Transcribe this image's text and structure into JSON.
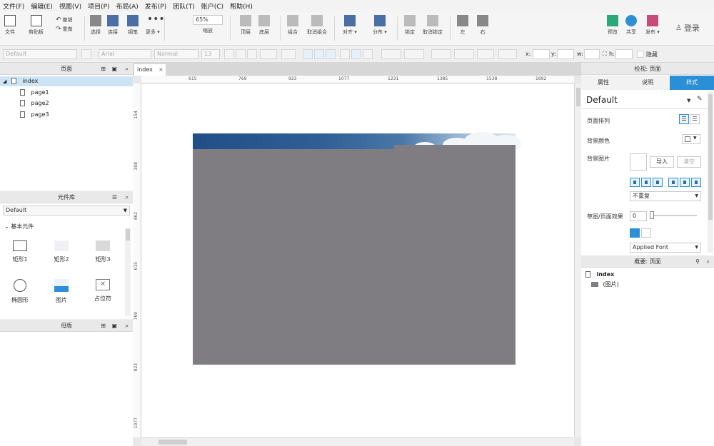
{
  "menu": [
    "文件(F)",
    "编辑(E)",
    "视图(V)",
    "项目(P)",
    "布局(A)",
    "发布(P)",
    "团队(T)",
    "账户(C)",
    "帮助(H)"
  ],
  "toolbar": {
    "new_label": "文件",
    "paste_label": "剪贴板",
    "undo_label": "撤销",
    "redo_label": "重做",
    "select_label": "选择",
    "connect_label": "连接",
    "pen_label": "钢笔",
    "more_label": "更多 ▾",
    "zoom_value": "65%",
    "zoom_label": "缩放",
    "top_label": "顶层",
    "bottom_label": "底层",
    "group_label": "组合",
    "ungroup_label": "取消组合",
    "align_label": "对齐 ▾",
    "distribute_label": "分布 ▾",
    "lock_label": "锁定",
    "unlock_label": "取消锁定",
    "left_label": "左",
    "right_label": "右",
    "preview_label": "预览",
    "share_label": "共享",
    "publish_label": "发布 ▾",
    "login_label": "登录"
  },
  "format": {
    "style_value": "Default",
    "font_value": "Arial",
    "weight_value": "Normal",
    "size_value": "13",
    "x_label": "x:",
    "y_label": "y:",
    "w_label": "w:",
    "h_label": "h:",
    "hide_label": "隐藏"
  },
  "pages_panel": {
    "title": "页面",
    "root": "index",
    "children": [
      "page1",
      "page2",
      "page3"
    ]
  },
  "library_panel": {
    "title": "元件库",
    "selected_library": "Default",
    "section": "基本元件",
    "items": [
      {
        "label": "矩形1",
        "icon": "rectangle-icon"
      },
      {
        "label": "矩形2",
        "icon": "rectangle-filled-icon"
      },
      {
        "label": "矩形3",
        "icon": "rectangle-gray-icon"
      },
      {
        "label": "椭圆形",
        "icon": "ellipse-icon"
      },
      {
        "label": "图片",
        "icon": "image-icon"
      },
      {
        "label": "占位符",
        "icon": "placeholder-icon"
      }
    ]
  },
  "masters_panel": {
    "title": "母版"
  },
  "canvas": {
    "tab_label": "index",
    "ruler_h": [
      "615",
      "769",
      "923",
      "1077",
      "1231",
      "1385",
      "1538",
      "1692"
    ],
    "ruler_v": [
      "154",
      "308",
      "462",
      "615",
      "769",
      "923",
      "1077"
    ]
  },
  "inspector": {
    "title": "检视: 页面",
    "tabs": [
      "属性",
      "说明",
      "样式"
    ],
    "active_tab": "样式",
    "style_name": "Default",
    "layout_label": "页面排列",
    "bg_color_label": "背景颜色",
    "bg_image_label": "背景图片",
    "import_label": "导入",
    "clear_label": "清空",
    "repeat_value": "不重复",
    "sketch_label": "草图/页面效果",
    "sketch_value": "0",
    "font_value": "Applied Font"
  },
  "outline": {
    "title": "概要: 页面",
    "root": "index",
    "child": "(图片)"
  }
}
